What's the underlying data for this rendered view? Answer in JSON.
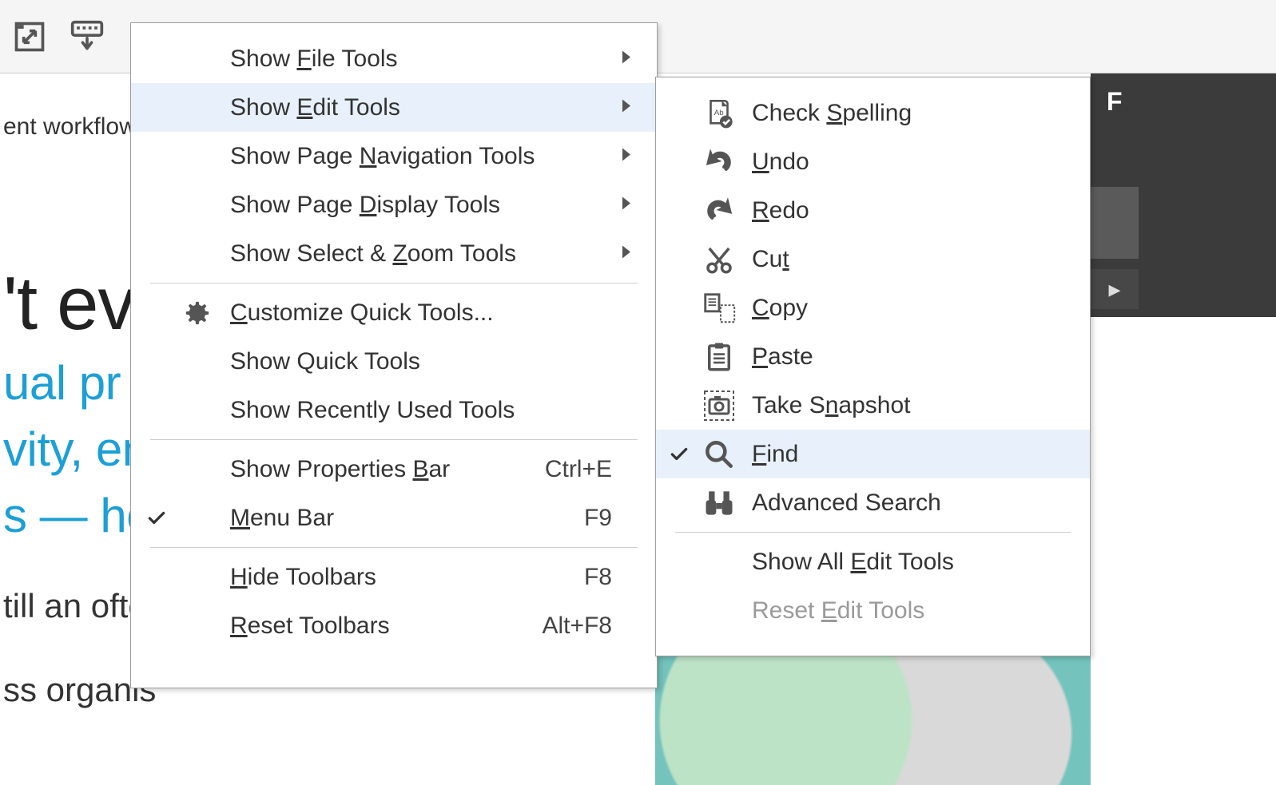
{
  "toolbar": {
    "icons": [
      "fullscreen-icon",
      "keyboard-download-icon"
    ]
  },
  "doc": {
    "small": "ent workflows",
    "h1": "'t ev",
    "sub1": "ual pr",
    "sub2": "vity, en",
    "sub3": "s — ho",
    "body1": "till an ofte",
    "body2": "ss organis"
  },
  "menu_left": [
    {
      "type": "item",
      "label_pre": "Show ",
      "u": "F",
      "label_post": "ile Tools",
      "arrow": true
    },
    {
      "type": "item",
      "label_pre": "Show ",
      "u": "E",
      "label_post": "dit Tools",
      "arrow": true,
      "highlight": true
    },
    {
      "type": "item",
      "label_pre": "Show Page ",
      "u": "N",
      "label_post": "avigation Tools",
      "arrow": true
    },
    {
      "type": "item",
      "label_pre": "Show Page ",
      "u": "D",
      "label_post": "isplay Tools",
      "arrow": true
    },
    {
      "type": "item",
      "label_pre": "Show Select & ",
      "u": "Z",
      "label_post": "oom Tools",
      "arrow": true
    },
    {
      "type": "sep"
    },
    {
      "type": "item",
      "icon": "gear",
      "label_pre": "",
      "u": "C",
      "label_post": "ustomize Quick Tools..."
    },
    {
      "type": "item",
      "label_pre": "Show Quick Tools",
      "u": "",
      "label_post": ""
    },
    {
      "type": "item",
      "label_pre": "Show Recently Used Tools",
      "u": "",
      "label_post": ""
    },
    {
      "type": "sep"
    },
    {
      "type": "item",
      "label_pre": "Show Properties ",
      "u": "B",
      "label_post": "ar",
      "shortcut": "Ctrl+E"
    },
    {
      "type": "item",
      "checked": true,
      "label_pre": "",
      "u": "M",
      "label_post": "enu Bar",
      "shortcut": "F9"
    },
    {
      "type": "sep"
    },
    {
      "type": "item",
      "label_pre": "",
      "u": "H",
      "label_post": "ide Toolbars",
      "shortcut": "F8"
    },
    {
      "type": "item",
      "label_pre": "",
      "u": "R",
      "label_post": "eset Toolbars",
      "shortcut": "Alt+F8"
    }
  ],
  "menu_right": [
    {
      "type": "item",
      "icon": "spellcheck",
      "label_pre": "Check ",
      "u": "S",
      "label_post": "pelling"
    },
    {
      "type": "item",
      "icon": "undo",
      "label_pre": "",
      "u": "U",
      "label_post": "ndo"
    },
    {
      "type": "item",
      "icon": "redo",
      "label_pre": "",
      "u": "R",
      "label_post": "edo"
    },
    {
      "type": "item",
      "icon": "cut",
      "label_pre": "Cu",
      "u": "t",
      "label_post": ""
    },
    {
      "type": "item",
      "icon": "copy",
      "label_pre": "",
      "u": "C",
      "label_post": "opy"
    },
    {
      "type": "item",
      "icon": "paste",
      "label_pre": "",
      "u": "P",
      "label_post": "aste"
    },
    {
      "type": "item",
      "icon": "snapshot",
      "label_pre": "Take S",
      "u": "n",
      "label_post": "apshot"
    },
    {
      "type": "item",
      "icon": "find",
      "checked": true,
      "highlight": true,
      "label_pre": "",
      "u": "F",
      "label_post": "ind"
    },
    {
      "type": "item",
      "icon": "binoculars",
      "label_pre": "Advanced Search",
      "u": "",
      "label_post": ""
    },
    {
      "type": "sep"
    },
    {
      "type": "item",
      "label_pre": "Show All ",
      "u": "E",
      "label_post": "dit Tools"
    },
    {
      "type": "item",
      "disabled": true,
      "label_pre": "Reset ",
      "u": "E",
      "label_post": "dit Tools"
    }
  ],
  "right_panel": {
    "letter": "F"
  }
}
